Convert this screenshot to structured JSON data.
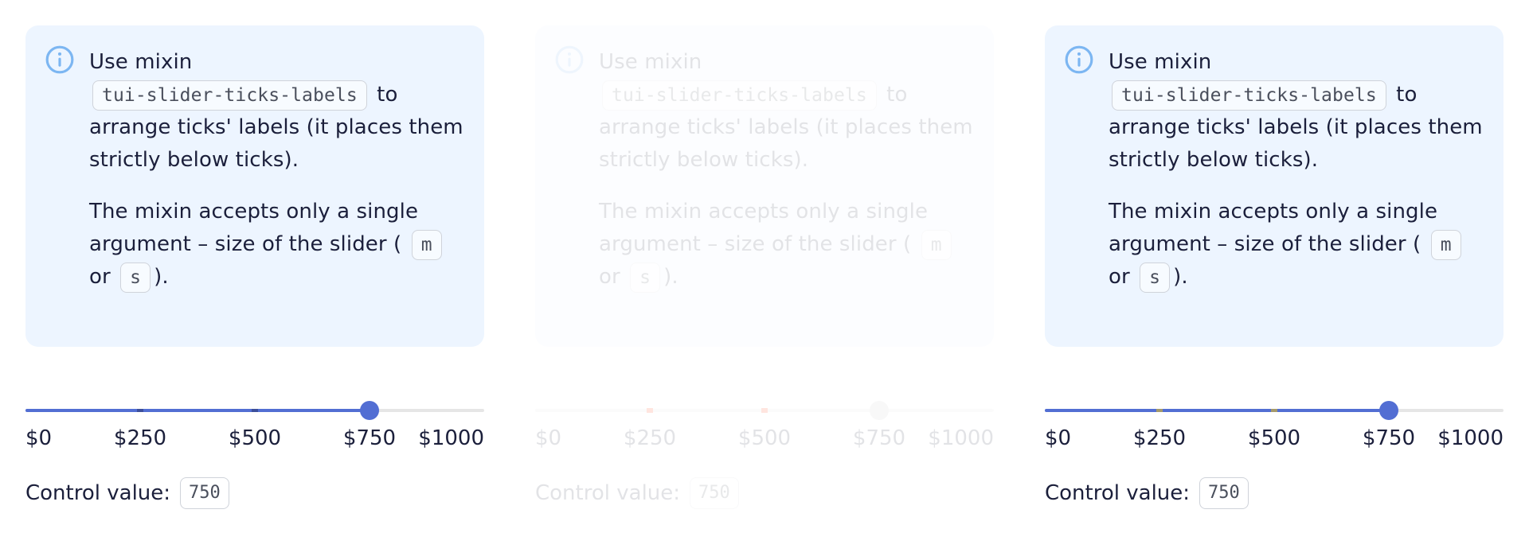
{
  "panels": [
    {
      "state": "enabled",
      "notice": {
        "line1": "Use mixin",
        "mixin_code": "tui-slider-ticks-labels",
        "line1_rest": "to arrange ticks' labels (it places them strictly below ticks).",
        "line2": "The mixin accepts only a single argument – size of the slider (",
        "code_m": "m",
        "or": "or",
        "code_s": "s",
        "end": ")."
      },
      "slider": {
        "min": 0,
        "max": 1000,
        "value": 750,
        "ticks": [
          "$0",
          "$250",
          "$500",
          "$750",
          "$1000"
        ]
      },
      "control_label": "Control value:",
      "control_value": "750"
    },
    {
      "state": "disabled",
      "notice": {
        "line1": "Use mixin",
        "mixin_code": "tui-slider-ticks-labels",
        "line1_rest": "to arrange ticks' labels (it places them strictly below ticks).",
        "line2": "The mixin accepts only a single argument – size of the slider (",
        "code_m": "m",
        "or": "or",
        "code_s": "s",
        "end": ")."
      },
      "slider": {
        "min": 0,
        "max": 1000,
        "value": 750,
        "ticks": [
          "$0",
          "$250",
          "$500",
          "$750",
          "$1000"
        ]
      },
      "control_label": "Control value:",
      "control_value": "750"
    },
    {
      "state": "enabled",
      "notice": {
        "line1": "Use mixin",
        "mixin_code": "tui-slider-ticks-labels",
        "line1_rest": "to arrange ticks' labels (it places them strictly below ticks).",
        "line2": "The mixin accepts only a single argument – size of the slider (",
        "code_m": "m",
        "or": "or",
        "code_s": "s",
        "end": ")."
      },
      "slider": {
        "min": 0,
        "max": 1000,
        "value": 750,
        "ticks": [
          "$0",
          "$250",
          "$500",
          "$750",
          "$1000"
        ]
      },
      "control_label": "Control value:",
      "control_value": "750"
    }
  ],
  "colors": {
    "accent": "#526ED3",
    "notice_bg": "#EDF5FF",
    "text": "#1B1F3B",
    "info_icon": "#7CB6F2"
  },
  "icons": {
    "info": "info-icon"
  }
}
